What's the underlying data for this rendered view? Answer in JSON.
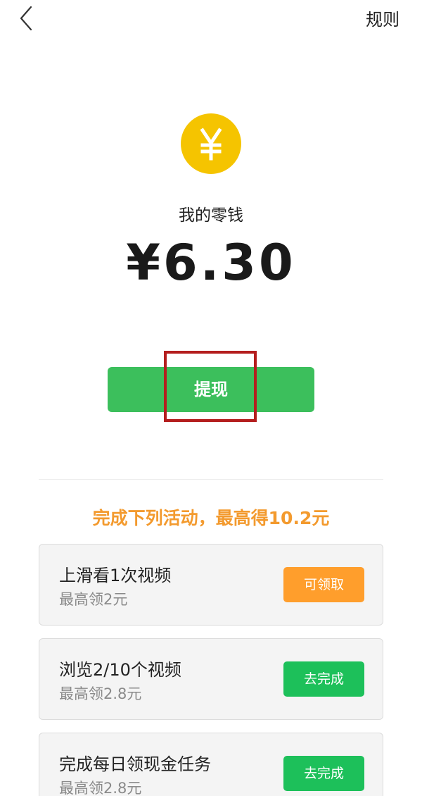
{
  "header": {
    "back_icon": "chevron-left-icon",
    "rules_label": "规则"
  },
  "wallet": {
    "coin_icon": "yen-coin-icon",
    "coin_color": "#F5C400",
    "label": "我的零钱",
    "balance": "¥6.30"
  },
  "withdraw": {
    "label": "提现",
    "color": "#3CBF5C"
  },
  "promo": {
    "text": "完成下列活动，最高得10.2元",
    "color": "#F39A2E"
  },
  "tasks": [
    {
      "title": "上滑看1次视频",
      "reward": "最高领2元",
      "button": "可领取",
      "button_color": "#FF9E2C"
    },
    {
      "title": "浏览2/10个视频",
      "reward": "最高领2.8元",
      "button": "去完成",
      "button_color": "#1DC05A"
    },
    {
      "title": "完成每日领现金任务",
      "reward": "最高领2.8元",
      "button": "去完成",
      "button_color": "#1DC05A"
    }
  ]
}
